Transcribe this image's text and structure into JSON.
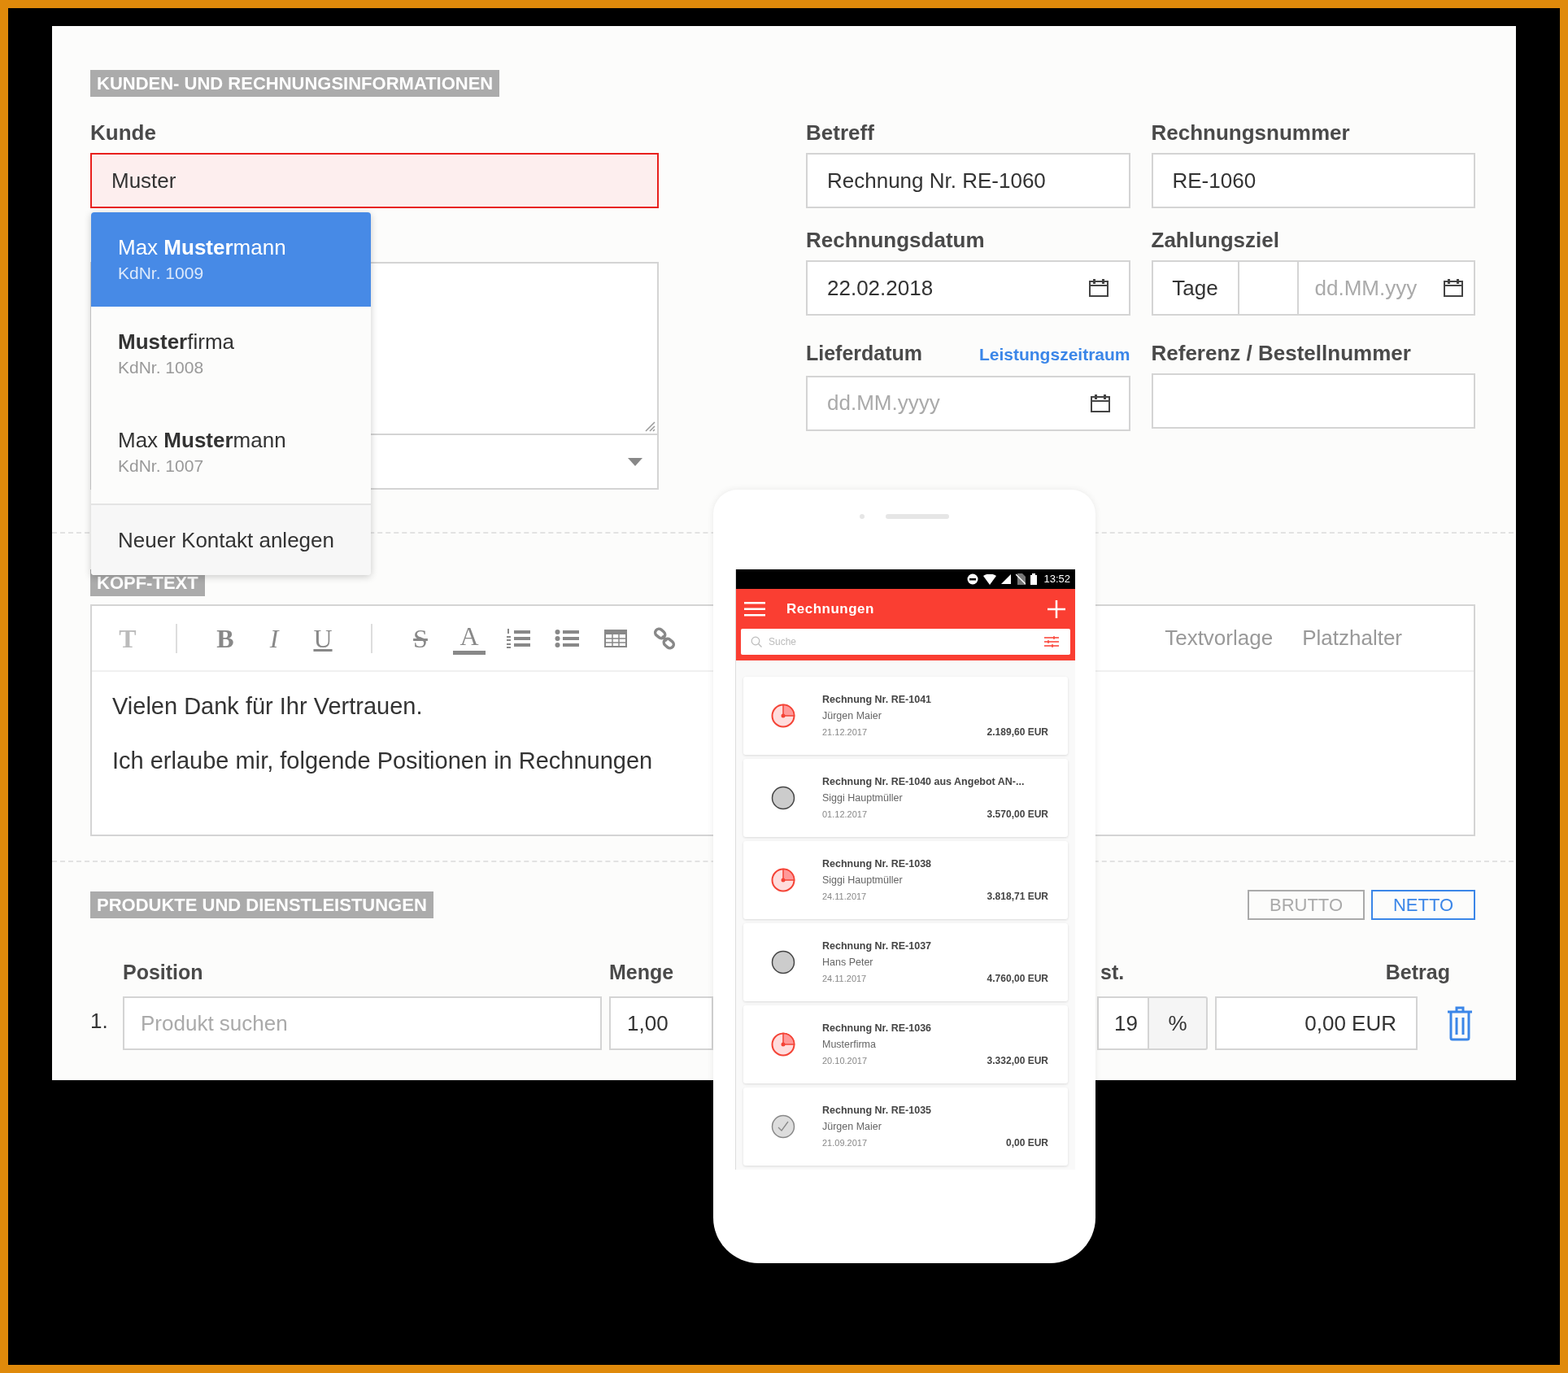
{
  "customer_section": {
    "header": "KUNDEN- UND RECHNUNGSINFORMATIONEN",
    "customer_label": "Kunde",
    "customer_value": "Muster",
    "customer_error": true,
    "suggestions": [
      {
        "name": "Max **Muster**mann",
        "number": "KdNr. 1009",
        "selected": true
      },
      {
        "name": "**Muster**firma",
        "number": "KdNr. 1008",
        "selected": false
      },
      {
        "name": "Max **Muster**mann",
        "number": "KdNr. 1007",
        "selected": false
      }
    ],
    "new_contact": "Neuer Kontakt anlegen"
  },
  "invoice_fields": {
    "subject": {
      "label": "Betreff",
      "value": "Rechnung Nr. RE-1060"
    },
    "invoice_number": {
      "label": "Rechnungsnummer",
      "value": "RE-1060"
    },
    "invoice_date": {
      "label": "Rechnungsdatum",
      "value": "22.02.2018"
    },
    "payment_term": {
      "label": "Zahlungsziel",
      "unit": "Tage",
      "placeholder": "dd.MM.yyy"
    },
    "delivery_date": {
      "label": "Lieferdatum",
      "link": "Leistungszeitraum",
      "placeholder": "dd.MM.yyyy"
    },
    "reference": {
      "label": "Referenz / Bestellnummer"
    }
  },
  "header_text": {
    "header": "KOPF-TEXT",
    "toolbar": [
      {
        "kind": "heading",
        "label": "T"
      },
      {
        "kind": "separator"
      },
      {
        "kind": "bold",
        "label": "B"
      },
      {
        "kind": "italic",
        "label": "I"
      },
      {
        "kind": "underline",
        "label": "U"
      },
      {
        "kind": "separator"
      },
      {
        "kind": "strike",
        "label": "S"
      },
      {
        "kind": "color",
        "label": "A"
      },
      {
        "kind": "ordered_list"
      },
      {
        "kind": "bullet_list"
      },
      {
        "kind": "table"
      },
      {
        "kind": "link"
      }
    ],
    "tabs": [
      "Textvorlage",
      "Platzhalter"
    ],
    "paragraphs": [
      "Vielen Dank für Ihr Vertrauen.",
      "Ich erlaube mir, folgende Positionen in Rechnungen"
    ]
  },
  "products": {
    "header": "PRODUKTE UND DIENSTLEISTUNGEN",
    "price_modes": [
      {
        "label": "BRUTTO",
        "selected": false
      },
      {
        "label": "NETTO",
        "selected": true
      }
    ],
    "columns": {
      "position": "Position",
      "quantity": "Menge",
      "column_3": "st.",
      "amount": "Betrag"
    },
    "rows": [
      {
        "index": "1.",
        "product_placeholder": "Produkt suchen",
        "quantity": "1,00",
        "vat": "19",
        "vat_unit": "%",
        "amount": "0,00 EUR"
      }
    ]
  },
  "phone": {
    "time": "13:52",
    "title": "Rechnungen",
    "search_placeholder": "Suche",
    "invoices": [
      {
        "title": "Rechnung Nr. RE-1041",
        "customer": "Jürgen Maier",
        "date": "21.12.2017",
        "amount": "2.189,60 EUR",
        "kind": "partial"
      },
      {
        "title": "Rechnung Nr. RE-1040 aus Angebot AN-...",
        "customer": "Siggi Hauptmüller",
        "date": "01.12.2017",
        "amount": "3.570,00 EUR",
        "kind": "open"
      },
      {
        "title": "Rechnung Nr. RE-1038",
        "customer": "Siggi Hauptmüller",
        "date": "24.11.2017",
        "amount": "3.818,71 EUR",
        "kind": "partial"
      },
      {
        "title": "Rechnung Nr. RE-1037",
        "customer": "Hans Peter",
        "date": "24.11.2017",
        "amount": "4.760,00 EUR",
        "kind": "open"
      },
      {
        "title": "Rechnung Nr. RE-1036",
        "customer": "Musterfirma",
        "date": "20.10.2017",
        "amount": "3.332,00 EUR",
        "kind": "partial"
      },
      {
        "title": "Rechnung Nr. RE-1035",
        "customer": "Jürgen Maier",
        "date": "21.09.2017",
        "amount": "0,00 EUR",
        "kind": "paid"
      }
    ]
  }
}
